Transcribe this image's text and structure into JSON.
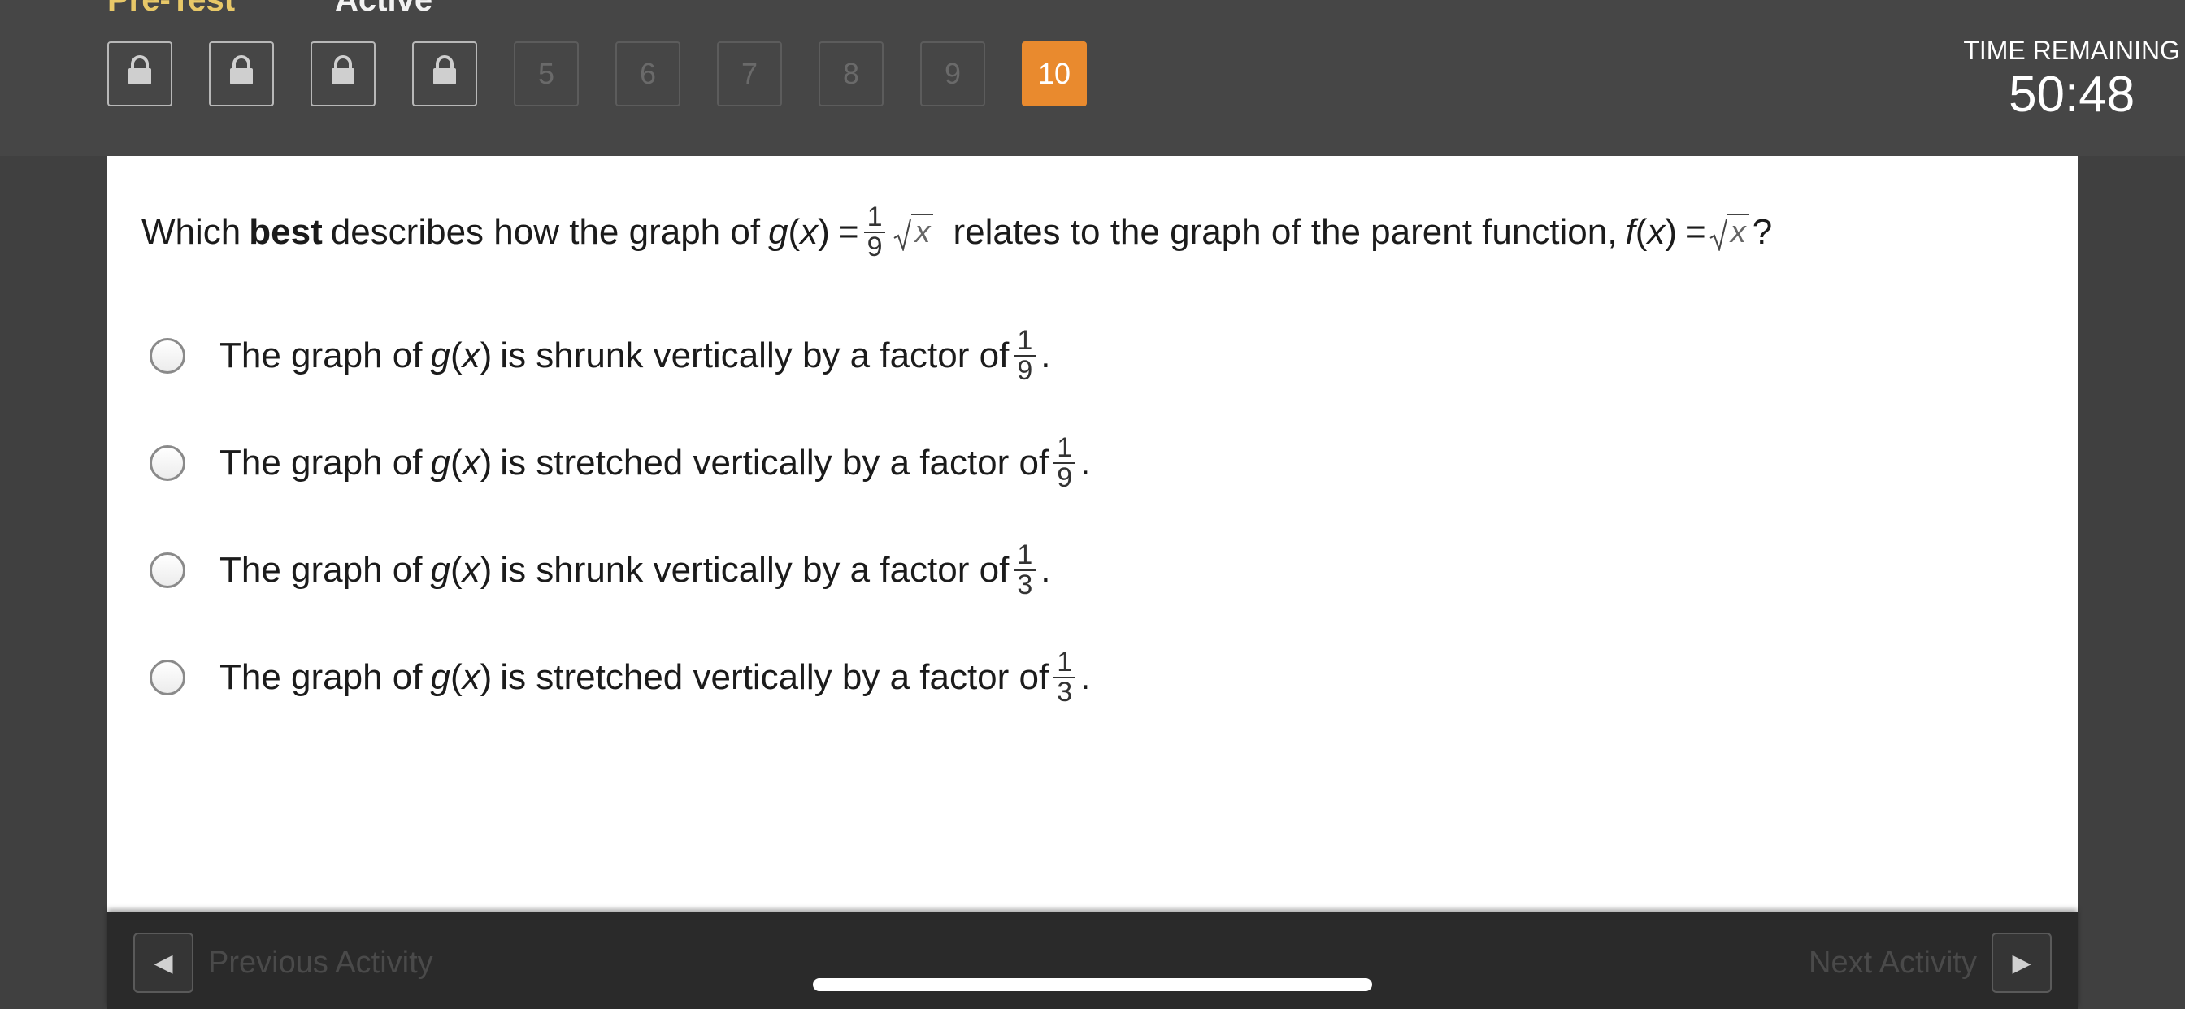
{
  "header": {
    "activity_title": "Pre-Test",
    "status": "Active",
    "questions": [
      {
        "label": "",
        "state": "locked"
      },
      {
        "label": "",
        "state": "locked"
      },
      {
        "label": "",
        "state": "locked"
      },
      {
        "label": "",
        "state": "locked"
      },
      {
        "label": "5",
        "state": "disabled"
      },
      {
        "label": "6",
        "state": "disabled"
      },
      {
        "label": "7",
        "state": "disabled"
      },
      {
        "label": "8",
        "state": "disabled"
      },
      {
        "label": "9",
        "state": "disabled"
      },
      {
        "label": "10",
        "state": "current"
      }
    ],
    "timer_label": "TIME REMAINING",
    "timer_value": "50:48"
  },
  "question": {
    "prefix": "Which",
    "bold": "best",
    "part1": "describes how the graph of",
    "g": "g",
    "x": "x",
    "equals": "=",
    "coef_num": "1",
    "coef_den": "9",
    "part2": "relates to the graph of the parent function,",
    "f": "f",
    "end": "?"
  },
  "options": [
    {
      "before": "The graph of",
      "g": "g",
      "x": "x",
      "verb": "is shrunk vertically by a factor of",
      "num": "1",
      "den": "9",
      "end": "."
    },
    {
      "before": "The graph of",
      "g": "g",
      "x": "x",
      "verb": "is stretched vertically by a factor of",
      "num": "1",
      "den": "9",
      "end": "."
    },
    {
      "before": "The graph of",
      "g": "g",
      "x": "x",
      "verb": "is shrunk vertically by a factor of",
      "num": "1",
      "den": "3",
      "end": "."
    },
    {
      "before": "The graph of",
      "g": "g",
      "x": "x",
      "verb": "is stretched vertically by a factor of",
      "num": "1",
      "den": "3",
      "end": "."
    }
  ],
  "footer": {
    "prev_label": "Previous Activity",
    "next_label": "Next Activity"
  },
  "colors": {
    "accent": "#e98a2e",
    "header_bg": "#464646",
    "footer_bg": "#2a2a2a"
  },
  "icons": {
    "locked_question": "lock-icon",
    "prev": "triangle-left-icon",
    "next": "triangle-right-icon"
  }
}
